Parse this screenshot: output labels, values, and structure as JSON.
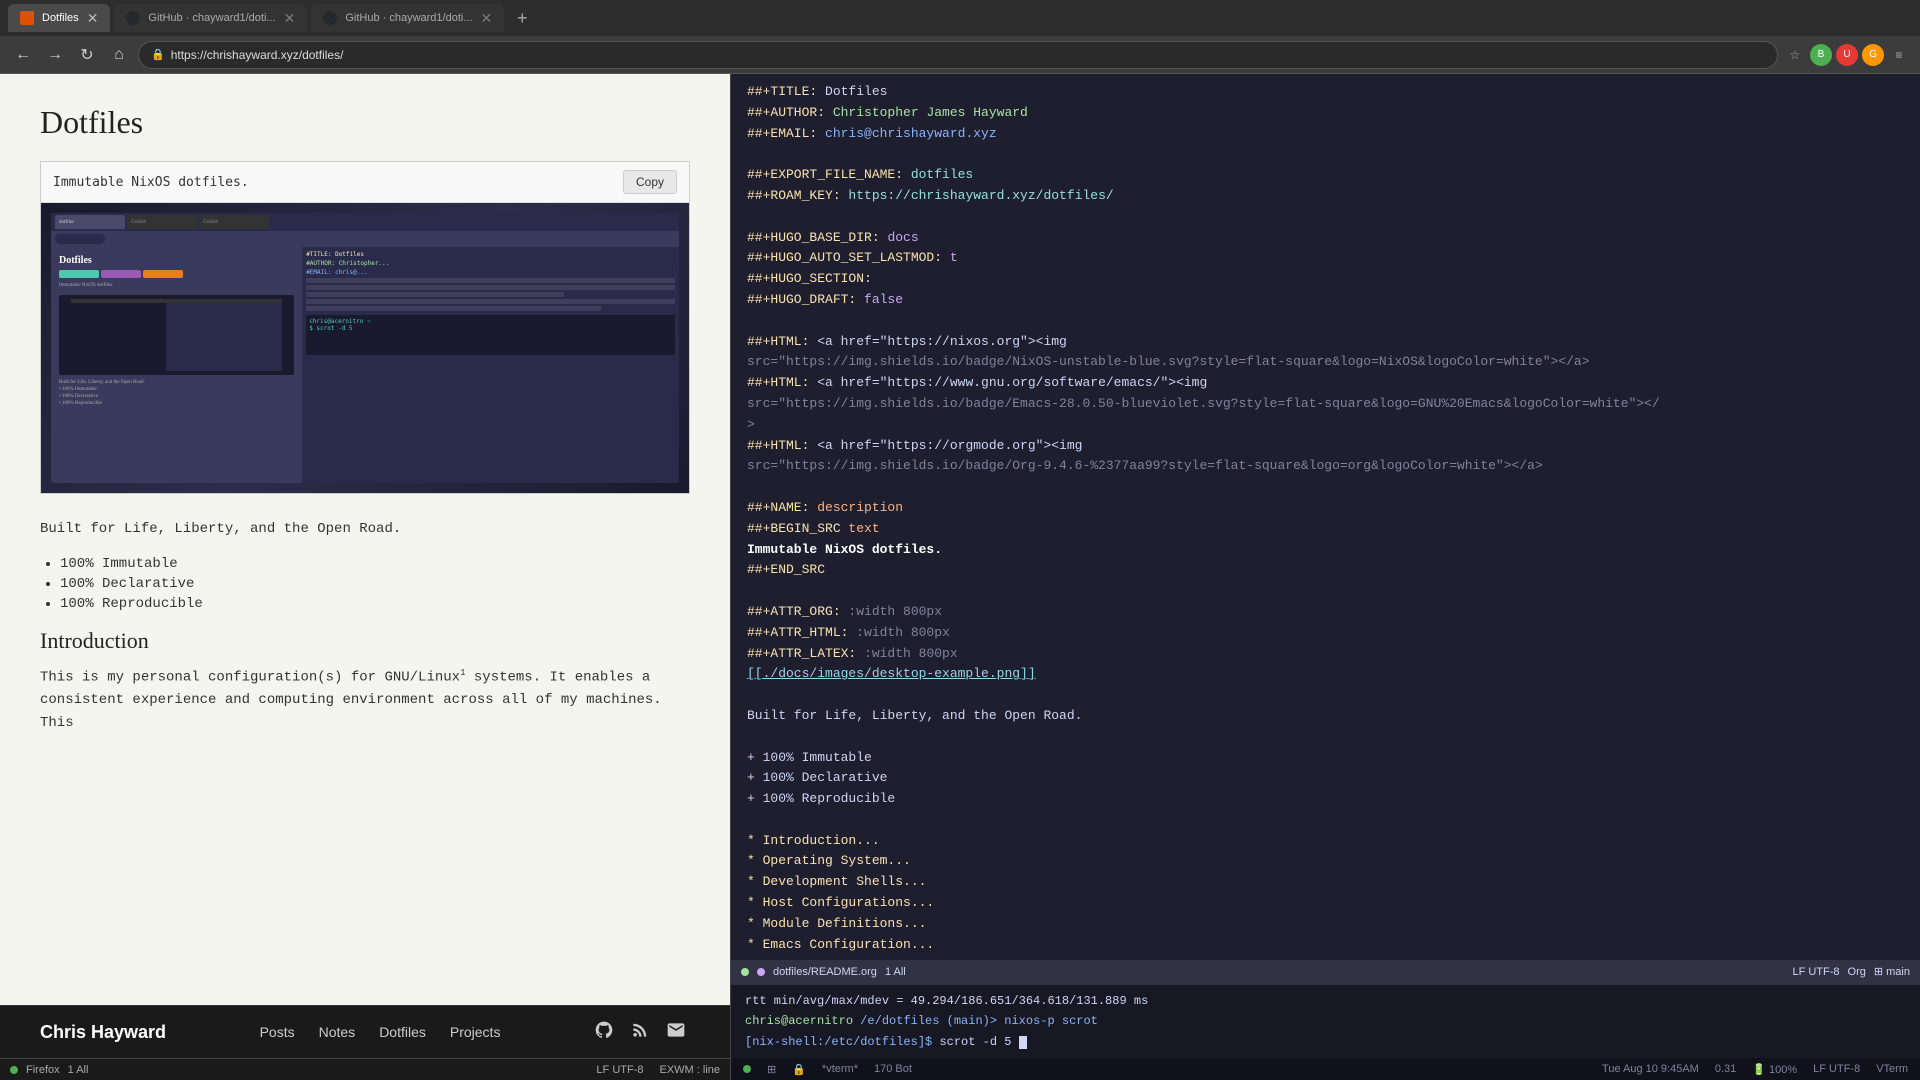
{
  "browser": {
    "tabs": [
      {
        "id": "tab1",
        "label": "Dotfiles",
        "active": true,
        "favicon_type": "orange"
      },
      {
        "id": "tab2",
        "label": "GitHub · chayward1/doti...",
        "active": false,
        "favicon_type": "github"
      },
      {
        "id": "tab3",
        "label": "GitHub · chayward1/doti...",
        "active": false,
        "favicon_type": "github"
      }
    ],
    "url": "https://chrishayward.xyz/dotfiles/",
    "nav_buttons": {
      "back": "←",
      "forward": "→",
      "refresh": "↻",
      "home": "⌂"
    }
  },
  "website": {
    "title": "Dotfiles",
    "screenshot_caption": "Immutable NixOS dotfiles.",
    "copy_button": "Copy",
    "body_text": "Built for Life, Liberty, and the Open Road.",
    "bullets": [
      "100% Immutable",
      "100% Declarative",
      "100% Reproducible"
    ],
    "introduction_heading": "Introduction",
    "intro_text": "This is my personal configuration(s) for GNU/Linux",
    "intro_sup": "1",
    "intro_text2": " systems. It enables a consistent experience and computing environment across all of my machines. This"
  },
  "site_nav": {
    "brand": "Chris Hayward",
    "links": [
      "Posts",
      "Notes",
      "Dotfiles",
      "Projects"
    ]
  },
  "browser_status": {
    "left": [
      "●",
      "Firefox",
      "1 All"
    ],
    "right": [
      "LF UTF-8",
      "EXWM : line"
    ]
  },
  "editor": {
    "lines": [
      {
        "text": "##+TITLE: Dotfiles",
        "color": "kw-yellow"
      },
      {
        "text": "##+AUTHOR: Christopher James Hayward",
        "color": "kw-green"
      },
      {
        "text": "##+EMAIL: chris@chrishayward.xyz",
        "color": "kw-blue"
      },
      {
        "text": "",
        "color": ""
      },
      {
        "text": "##+EXPORT_FILE_NAME: dotfiles",
        "color": "kw-teal"
      },
      {
        "text": "##+ROAM_KEY: https://chrishayward.xyz/dotfiles/",
        "color": "kw-teal"
      },
      {
        "text": "",
        "color": ""
      },
      {
        "text": "##+HUGO_BASE_DIR: docs",
        "color": "kw-purple"
      },
      {
        "text": "##+HUGO_AUTO_SET_LASTMOD: t",
        "color": "kw-purple"
      },
      {
        "text": "##+HUGO_SECTION:",
        "color": "kw-purple"
      },
      {
        "text": "##+HUGO_DRAFT: false",
        "color": "kw-purple"
      },
      {
        "text": "",
        "color": ""
      },
      {
        "text": "##+HTML: <a href=\"https://nixos.org\"><img",
        "color": "kw-white"
      },
      {
        "text": "src=\"https://img.shields.io/badge/NixOS-unstable-blue.svg?style=flat-square&logo=NixOS&logoColor=white\"></a>",
        "color": "kw-gray"
      },
      {
        "text": "##+HTML: <a href=\"https://www.gnu.org/software/emacs/\"><img",
        "color": "kw-white"
      },
      {
        "text": "src=\"https://img.shields.io/badge/Emacs-28.0.50-blueviolet.svg?style=flat-square&logo=GNU%20Emacs&logoColor=white\"></",
        "color": "kw-gray"
      },
      {
        "text": ">",
        "color": "kw-gray"
      },
      {
        "text": "##+HTML: <a href=\"https://orgmode.org\"><img",
        "color": "kw-white"
      },
      {
        "text": "src=\"https://img.shields.io/badge/Org-9.4.6-%2377aa99?style=flat-square&logo=org&logoColor=white\"></a>",
        "color": "kw-gray"
      },
      {
        "text": "",
        "color": ""
      },
      {
        "text": "##+NAME: description",
        "color": "kw-orange"
      },
      {
        "text": "##+BEGIN_SRC text",
        "color": "kw-orange"
      },
      {
        "text": "Immutable NixOS dotfiles.",
        "color": "kw-bold-white"
      },
      {
        "text": "##+END_SRC",
        "color": "kw-orange"
      },
      {
        "text": "",
        "color": ""
      },
      {
        "text": "##+ATTR_ORG: :width 800px",
        "color": "kw-gray"
      },
      {
        "text": "##+ATTR_HTML: :width 800px",
        "color": "kw-gray"
      },
      {
        "text": "##+ATTR_LATEX: :width 800px",
        "color": "kw-gray"
      },
      {
        "text": "[[./docs/images/desktop-example.png]]",
        "color": "kw-link"
      },
      {
        "text": "",
        "color": ""
      },
      {
        "text": "Built for Life, Liberty, and the Open Road.",
        "color": "kw-white"
      },
      {
        "text": "",
        "color": ""
      },
      {
        "text": "+ 100% Immutable",
        "color": "kw-white"
      },
      {
        "text": "+ 100% Declarative",
        "color": "kw-white"
      },
      {
        "text": "+ 100% Reproducible",
        "color": "kw-white"
      },
      {
        "text": "",
        "color": ""
      },
      {
        "text": "* Introduction...",
        "color": "kw-yellow"
      },
      {
        "text": "* Operating System...",
        "color": "kw-yellow"
      },
      {
        "text": "* Development Shells...",
        "color": "kw-yellow"
      },
      {
        "text": "* Host Configurations...",
        "color": "kw-yellow"
      },
      {
        "text": "* Module Definitions...",
        "color": "kw-yellow"
      },
      {
        "text": "* Emacs Configuration...",
        "color": "kw-yellow"
      }
    ],
    "status_bar": {
      "dot1_color": "#a6e3a1",
      "dot2_color": "#cba6f7",
      "filename": "dotfiles/README.org",
      "info": "1 All",
      "encoding": "LF UTF-8",
      "mode": "Org",
      "extra": "⊞ main"
    }
  },
  "terminal": {
    "rtt_line": "rtt min/avg/max/mdev = 49.294/186.651/364.618/131.889 ms",
    "prompt_user": "chris@acernitro",
    "prompt_path": "/e/dotfiles (main)>",
    "prev_cmd": "nixos-p scrot",
    "shell_prompt": "[nix-shell:/etc/dotfiles]$",
    "cmd": "scrot -d 5",
    "cursor": true
  },
  "bottom_status": {
    "left": [
      "●",
      "⊞",
      "🔒",
      "*vterm*",
      "170 Bot"
    ],
    "right": [
      "Tue Aug 10 9:45AM",
      "0.31",
      "🔋 100%",
      "LF UTF-8",
      "VTerm"
    ]
  }
}
